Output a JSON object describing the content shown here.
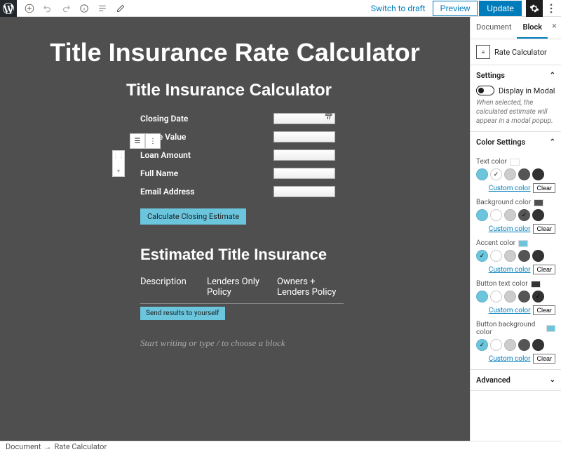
{
  "topbar": {
    "switch_draft": "Switch to draft",
    "preview": "Preview",
    "update": "Update"
  },
  "tabs": {
    "document": "Document",
    "block": "Block"
  },
  "block_card": {
    "name": "Rate Calculator"
  },
  "settings": {
    "title": "Settings",
    "modal_label": "Display in Modal",
    "modal_help": "When selected, the calculated estimate will appear in a modal popup."
  },
  "color_panel": {
    "title": "Color Settings",
    "labels": {
      "text": "Text color",
      "background": "Background color",
      "accent": "Accent color",
      "button_text": "Button text color",
      "button_bg": "Button background color"
    },
    "custom": "Custom color",
    "clear": "Clear",
    "palette": [
      "#6ac5dd",
      "#ffffff",
      "#cccccc",
      "#555555",
      "#333333"
    ],
    "current": {
      "text": "#ffffff",
      "background": "#4f4f4f",
      "accent": "#6ac5dd",
      "button_text": "#333333",
      "button_bg": "#6ac5dd"
    }
  },
  "advanced": {
    "title": "Advanced"
  },
  "page": {
    "title": "Title Insurance Rate Calculator",
    "calc_title": "Title Insurance Calculator",
    "fields": {
      "closing_date": "Closing Date",
      "home_value": "Home Value",
      "loan_amount": "Loan Amount",
      "full_name": "Full Name",
      "email": "Email Address"
    },
    "calc_button": "Calculate Closing Estimate",
    "est_title": "Estimated Title Insurance",
    "table": {
      "c1": "Description",
      "c2": "Lenders Only Policy",
      "c3": "Owners + Lenders Policy"
    },
    "send_button": "Send results to yourself",
    "placeholder": "Start writing or type / to choose a block"
  },
  "footer": {
    "document": "Document",
    "block": "Rate Calculator"
  }
}
